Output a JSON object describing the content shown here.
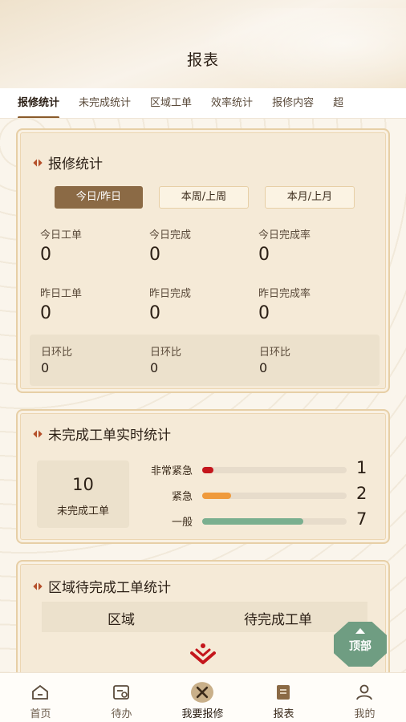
{
  "header": {
    "title": "报表"
  },
  "tabs": [
    {
      "label": "报修统计"
    },
    {
      "label": "未完成统计"
    },
    {
      "label": "区域工单"
    },
    {
      "label": "效率统计"
    },
    {
      "label": "报修内容"
    },
    {
      "label": "超"
    }
  ],
  "repair_stats": {
    "title": "报修统计",
    "periods": [
      "今日/昨日",
      "本周/上周",
      "本月/上月"
    ],
    "today_orders_label": "今日工单",
    "today_orders": "0",
    "today_done_label": "今日完成",
    "today_done": "0",
    "today_rate_label": "今日完成率",
    "today_rate": "0",
    "yesterday_orders_label": "昨日工单",
    "yesterday_orders": "0",
    "yesterday_done_label": "昨日完成",
    "yesterday_done": "0",
    "yesterday_rate_label": "昨日完成率",
    "yesterday_rate": "0",
    "ratio_labels": [
      "日环比",
      "日环比",
      "日环比"
    ],
    "ratio_values": [
      "0",
      "0",
      "0"
    ]
  },
  "unfinished": {
    "title": "未完成工单实时统计",
    "total": "10",
    "total_label": "未完成工单",
    "levels": [
      {
        "label": "非常紧急",
        "count": "1",
        "fraction": 0.08,
        "color": "#c4161c"
      },
      {
        "label": "紧急",
        "count": "2",
        "fraction": 0.2,
        "color": "#ef9a3c"
      },
      {
        "label": "一般",
        "count": "7",
        "fraction": 0.7,
        "color": "#7aaf8f"
      }
    ]
  },
  "region": {
    "title": "区域待完成工单统计",
    "col_region": "区域",
    "col_pending": "待完成工单"
  },
  "back_top_label": "顶部",
  "nav": [
    {
      "label": "首页",
      "icon": "home-icon"
    },
    {
      "label": "待办",
      "icon": "todo-icon"
    },
    {
      "label": "我要报修",
      "icon": "repair-tools-icon"
    },
    {
      "label": "报表",
      "icon": "report-icon"
    },
    {
      "label": "我的",
      "icon": "user-icon"
    }
  ],
  "colors": {
    "accent": "#8b6a45",
    "back_top": "#6f9d82",
    "brand_red": "#c4161c"
  }
}
